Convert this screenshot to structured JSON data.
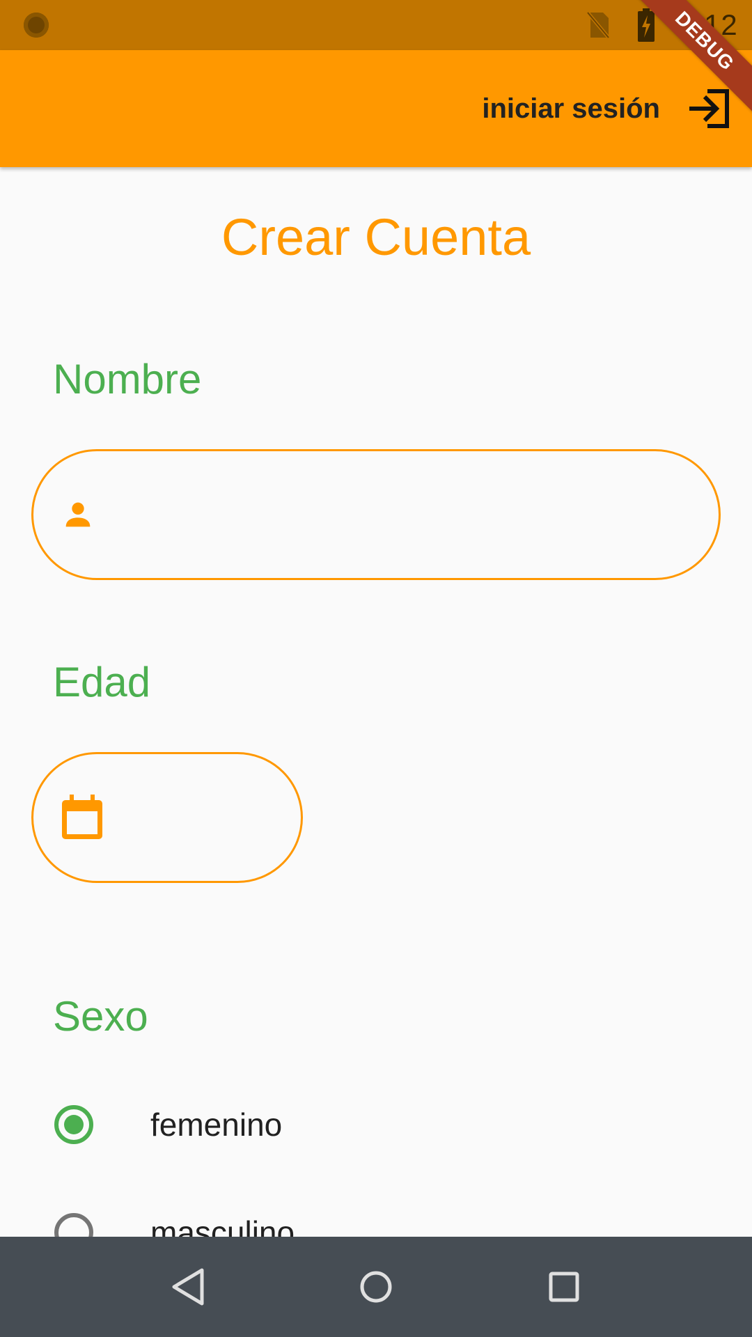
{
  "status_bar": {
    "time": "2:12",
    "icons": [
      "loading-indicator-icon",
      "no-sim-icon",
      "battery-charging-icon"
    ]
  },
  "debug_banner": {
    "label": "DEBUG"
  },
  "app_bar": {
    "login_label": "iniciar sesión",
    "login_icon": "login-icon",
    "background_color": "#ff9800"
  },
  "page": {
    "title": "Crear Cuenta",
    "accent_color": "#ff9800",
    "label_color": "#4caf50"
  },
  "form": {
    "nombre": {
      "label": "Nombre",
      "value": "",
      "icon": "person-icon"
    },
    "edad": {
      "label": "Edad",
      "value": "",
      "icon": "calendar-icon"
    },
    "sexo": {
      "label": "Sexo",
      "options": [
        {
          "label": "femenino",
          "selected": true
        },
        {
          "label": "masculino",
          "selected": false
        }
      ]
    }
  },
  "nav_bar": {
    "buttons": [
      "back-icon",
      "home-icon",
      "recents-icon"
    ]
  }
}
